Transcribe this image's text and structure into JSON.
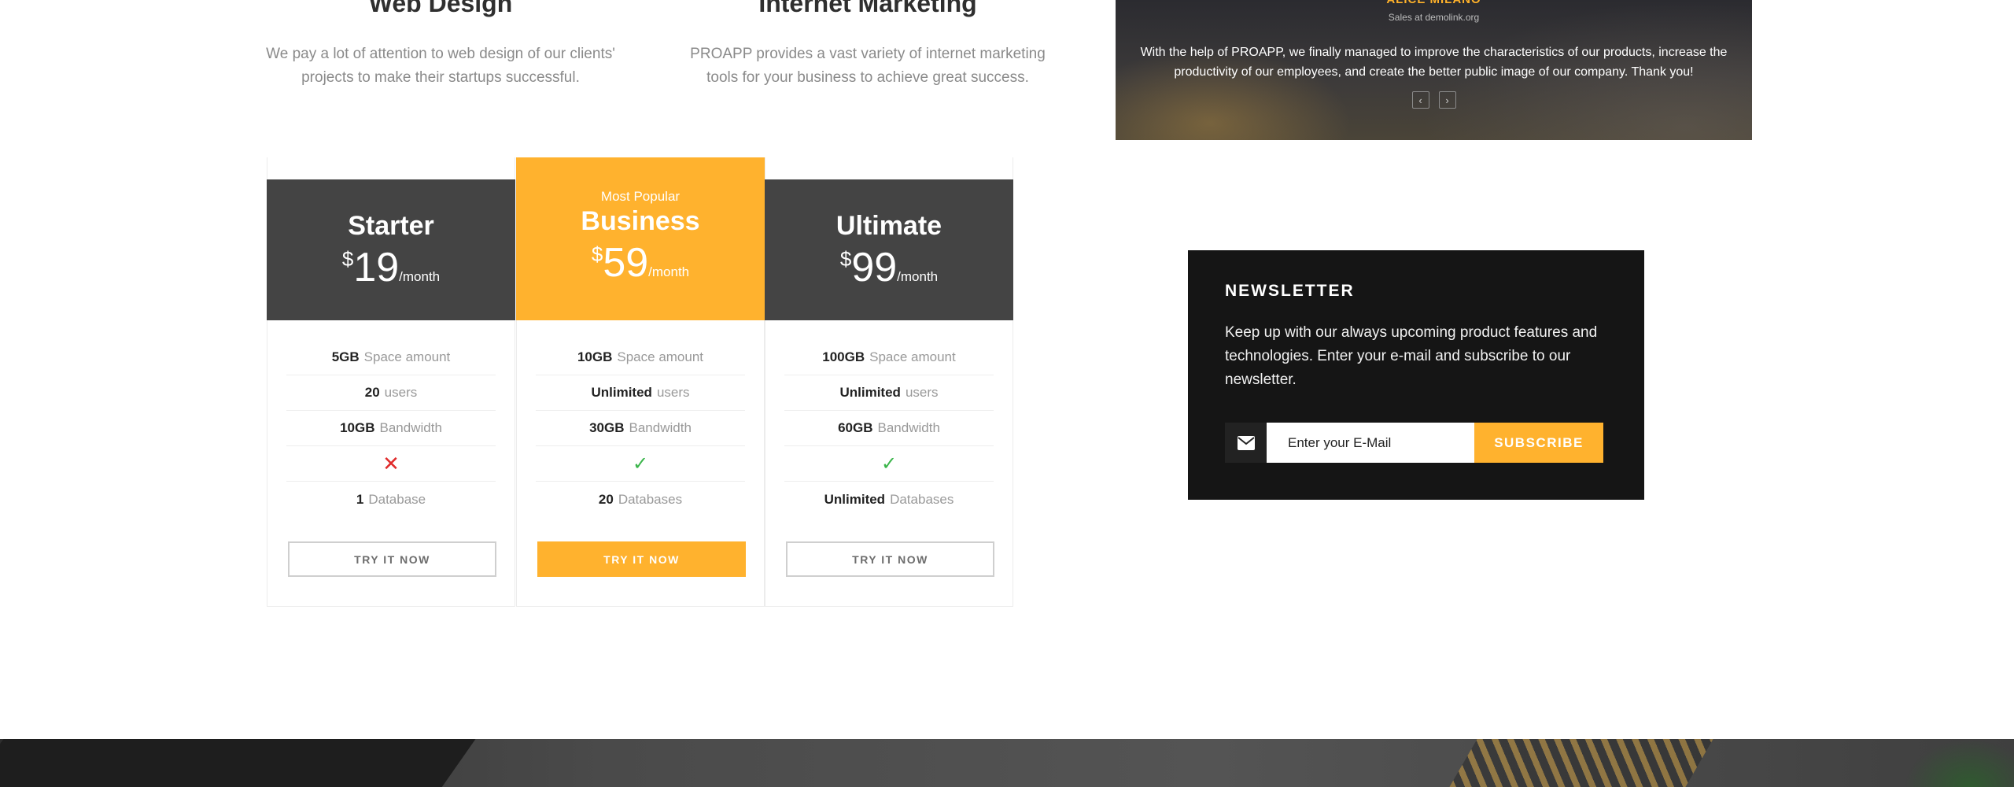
{
  "features": [
    {
      "title": "Web Design",
      "text": "We pay a lot of attention to web design of our clients' projects to make their startups successful."
    },
    {
      "title": "Internet Marketing",
      "text": "PROAPP provides a vast variety of internet marketing tools for your business to achieve great success."
    }
  ],
  "testimonial": {
    "name": "ALICE MILANO",
    "role": "Sales at demolink.org",
    "quote": "With the help of PROAPP, we finally managed to improve the characteristics of our products, increase the productivity of our employees, and create the better public image of our company. Thank you!",
    "prev_icon": "chevron-left-icon",
    "next_icon": "chevron-right-icon"
  },
  "pricing": {
    "currency": "$",
    "period": "/month",
    "plans": [
      {
        "name": "Starter",
        "badge": "",
        "price": "19",
        "rows": [
          {
            "strong": "5GB",
            "label": "Space amount"
          },
          {
            "strong": "20",
            "label": "users"
          },
          {
            "strong": "10GB",
            "label": "Bandwidth"
          },
          {
            "icon": "cross-icon",
            "glyph": "✕"
          },
          {
            "strong": "1",
            "label": "Database"
          }
        ],
        "button": "TRY IT NOW"
      },
      {
        "name": "Business",
        "badge": "Most Popular",
        "price": "59",
        "rows": [
          {
            "strong": "10GB",
            "label": "Space amount"
          },
          {
            "strong": "Unlimited",
            "label": "users"
          },
          {
            "strong": "30GB",
            "label": "Bandwidth"
          },
          {
            "icon": "check-icon",
            "glyph": "✓"
          },
          {
            "strong": "20",
            "label": "Databases"
          }
        ],
        "button": "TRY IT NOW"
      },
      {
        "name": "Ultimate",
        "badge": "",
        "price": "99",
        "rows": [
          {
            "strong": "100GB",
            "label": "Space amount"
          },
          {
            "strong": "Unlimited",
            "label": "users"
          },
          {
            "strong": "60GB",
            "label": "Bandwidth"
          },
          {
            "icon": "check-icon",
            "glyph": "✓"
          },
          {
            "strong": "Unlimited",
            "label": "Databases"
          }
        ],
        "button": "TRY IT NOW"
      }
    ]
  },
  "newsletter": {
    "title": "NEWSLETTER",
    "text": "Keep up with our always upcoming product features and technologies. Enter your e-mail and subscribe to our newsletter.",
    "placeholder": "Enter your E-Mail",
    "button": "SUBSCRIBE",
    "icon": "mail-icon"
  },
  "colors": {
    "accent": "#ffb22e",
    "dark_header": "#444444",
    "newsletter_bg": "#151515",
    "check": "#3ab54a",
    "cross": "#e02b2b"
  }
}
